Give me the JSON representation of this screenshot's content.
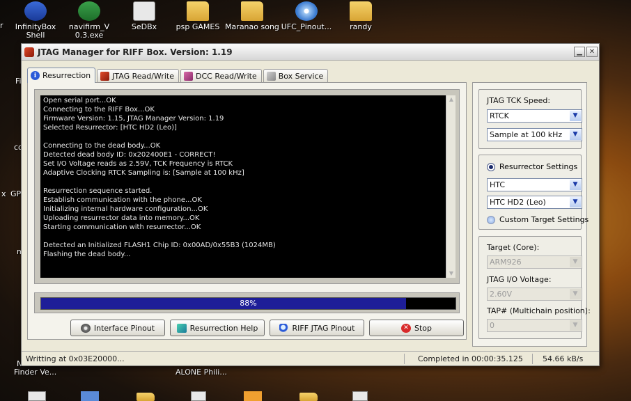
{
  "desktop": {
    "icons": [
      {
        "label": "InfinityBox\nShell",
        "glyph": "shell"
      },
      {
        "label": "navifirm_V\n0.3.exe",
        "glyph": "exe"
      },
      {
        "label": "SeDBx",
        "glyph": "doc"
      },
      {
        "label": "psp GAMES",
        "glyph": "folder"
      },
      {
        "label": "Maranao song",
        "glyph": "folder"
      },
      {
        "label": "UFC_Pinout...",
        "glyph": "cd"
      },
      {
        "label": "randy",
        "glyph": "folder"
      }
    ],
    "edge_labels": [
      "r",
      "Fi",
      "co",
      "x",
      "GPI",
      "m",
      "N",
      "Finder Ve...",
      "ALONE Phili..."
    ]
  },
  "window": {
    "title": "JTAG Manager for RIFF Box. Version: 1.19",
    "minimize_glyph": "▁",
    "close_glyph": "✕",
    "tabs": [
      {
        "label": "Resurrection",
        "icon": "info-icon",
        "glyph": "i",
        "active": true
      },
      {
        "label": "JTAG Read/Write",
        "icon": "jtag-rw-icon",
        "glyph": "",
        "active": false
      },
      {
        "label": "DCC Read/Write",
        "icon": "dcc-rw-icon",
        "glyph": "",
        "active": false
      },
      {
        "label": "Box Service",
        "icon": "box-service-icon",
        "glyph": "",
        "active": false
      }
    ],
    "log_lines": [
      "Open serial port...OK",
      "Connecting to the RIFF Box...OK",
      "Firmware Version: 1.15, JTAG Manager Version: 1.19",
      "Selected Resurrector: [HTC HD2 (Leo)]",
      "",
      "Connecting to the dead body...OK",
      "Detected dead body ID: 0x202400E1 - CORRECT!",
      "Set I/O Voltage reads as 2.59V, TCK Frequency is RTCK",
      "Adaptive Clocking RTCK Sampling is: [Sample at 100 kHz]",
      "",
      "Resurrection sequence started.",
      "Establish communication with the phone...OK",
      "Initializing internal hardware configuration...OK",
      "Uploading resurrector data into memory...OK",
      "Starting communication with resurrector...OK",
      "",
      "Detected an Initialized FLASH1 Chip ID: 0x00AD/0x55B3 (1024MB)",
      "Flashing the dead body..."
    ],
    "scroll_up": "▲",
    "scroll_down": "▼",
    "progress": {
      "value": 0.88,
      "label": "88%"
    },
    "buttons": {
      "interface_pinout": "Interface Pinout",
      "resurrection_help": "Resurrection Help",
      "riff_jtag_pinout": "RIFF JTAG Pinout",
      "stop": "Stop",
      "stop_glyph": "✕"
    },
    "side": {
      "tck_label": "JTAG TCK Speed:",
      "tck_value": "RTCK",
      "sample_value": "Sample at 100 kHz",
      "resurrector_settings": "Resurrector Settings",
      "vendor_value": "HTC",
      "model_value": "HTC HD2 (Leo)",
      "custom_target": "Custom Target Settings",
      "target_core_label": "Target (Core):",
      "target_core_value": "ARM926",
      "io_voltage_label": "JTAG I/O Voltage:",
      "io_voltage_value": "2.60V",
      "tap_label": "TAP# (Multichain position):",
      "tap_value": "0",
      "combo_arrow": "▼"
    },
    "status": {
      "left": "Writting at 0x03E20000...",
      "completed": "Completed in 00:00:35.125",
      "speed": "54.66 kB/s"
    }
  }
}
